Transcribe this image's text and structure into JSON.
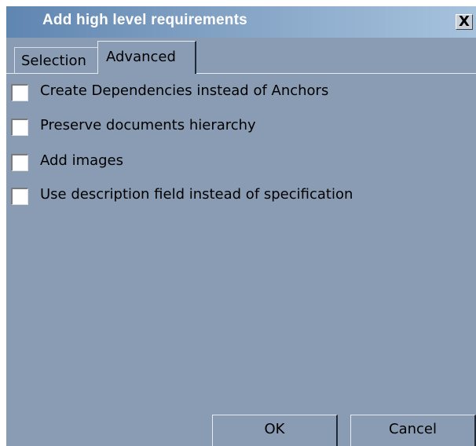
{
  "window": {
    "title": "Add high level requirements",
    "close_label": "X"
  },
  "tabs": [
    {
      "label": "Selection",
      "active": false
    },
    {
      "label": "Advanced",
      "active": true
    }
  ],
  "options": [
    {
      "label": "Create Dependencies instead of Anchors",
      "checked": false
    },
    {
      "label": "Preserve documents hierarchy",
      "checked": false
    },
    {
      "label": "Add images",
      "checked": false
    },
    {
      "label": "Use description field instead of specification",
      "checked": false
    }
  ],
  "buttons": {
    "ok_label": "OK",
    "cancel_label": "Cancel"
  },
  "colors": {
    "dialog_background": "#8a9cb3",
    "title_gradient_start": "#5f86b1",
    "title_gradient_end": "#a6c2dd",
    "title_text": "#ffffff"
  }
}
